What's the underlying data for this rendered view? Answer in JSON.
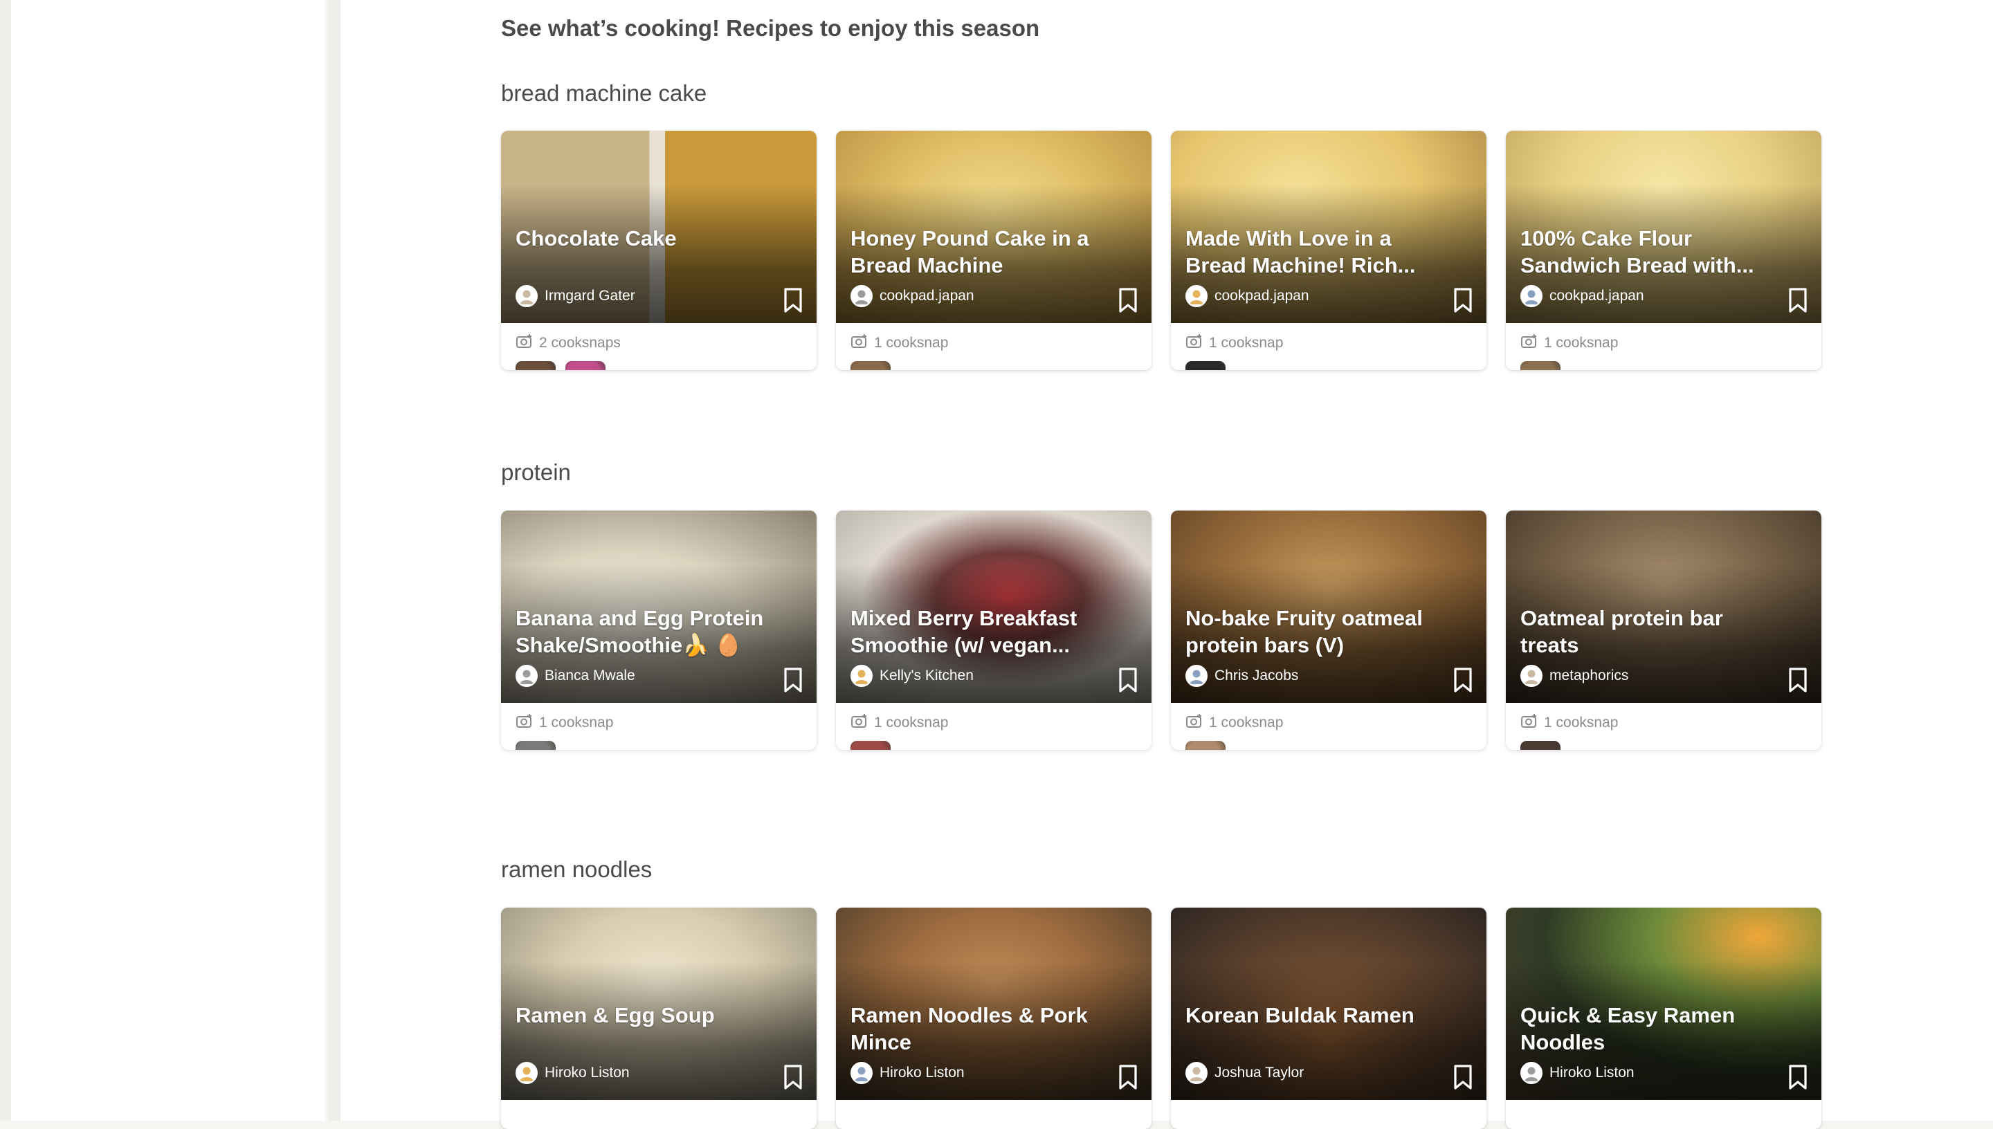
{
  "page_title": "See what’s cooking! Recipes to enjoy this season",
  "sections": [
    {
      "title": "bread machine cake",
      "cards": [
        {
          "title": "Chocolate Cake",
          "author": "Irmgard Gater",
          "cooksnaps": "2 cooksnaps",
          "snap_count": 2
        },
        {
          "title": "Honey Pound Cake in a Bread Machine",
          "author": "cookpad.japan",
          "cooksnaps": "1 cooksnap",
          "snap_count": 1
        },
        {
          "title": "Made With Love in a Bread Machine! Rich...",
          "author": "cookpad.japan",
          "cooksnaps": "1 cooksnap",
          "snap_count": 1
        },
        {
          "title": "100% Cake Flour Sandwich Bread with...",
          "author": "cookpad.japan",
          "cooksnaps": "1 cooksnap",
          "snap_count": 1
        }
      ]
    },
    {
      "title": "protein",
      "cards": [
        {
          "title": "Banana and Egg Protein Shake/Smoothie🍌 🥚 ...",
          "author": "Bianca Mwale",
          "cooksnaps": "1 cooksnap",
          "snap_count": 1
        },
        {
          "title": "Mixed Berry Breakfast Smoothie (w/ vegan...",
          "author": "Kelly's Kitchen",
          "cooksnaps": "1 cooksnap",
          "snap_count": 1
        },
        {
          "title": "No-bake Fruity oatmeal protein bars (V)",
          "author": "Chris Jacobs",
          "cooksnaps": "1 cooksnap",
          "snap_count": 1
        },
        {
          "title": "Oatmeal protein bar treats",
          "author": "metaphorics",
          "cooksnaps": "1 cooksnap",
          "snap_count": 1
        }
      ]
    },
    {
      "title": "ramen noodles",
      "cards": [
        {
          "title": "Ramen & Egg Soup",
          "author": "Hiroko Liston"
        },
        {
          "title": "Ramen Noodles & Pork Mince",
          "author": "Hiroko Liston"
        },
        {
          "title": "Korean Buldak Ramen",
          "author": "Joshua Taylor"
        },
        {
          "title": "Quick & Easy Ramen Noodles",
          "author": "Hiroko Liston"
        }
      ]
    }
  ],
  "colors": {
    "background": "#ffffff",
    "text": "#4a4a4a",
    "muted": "#8a8a8a"
  },
  "icons": {
    "bookmark": "bookmark-icon",
    "cooksnap": "camera-icon"
  }
}
